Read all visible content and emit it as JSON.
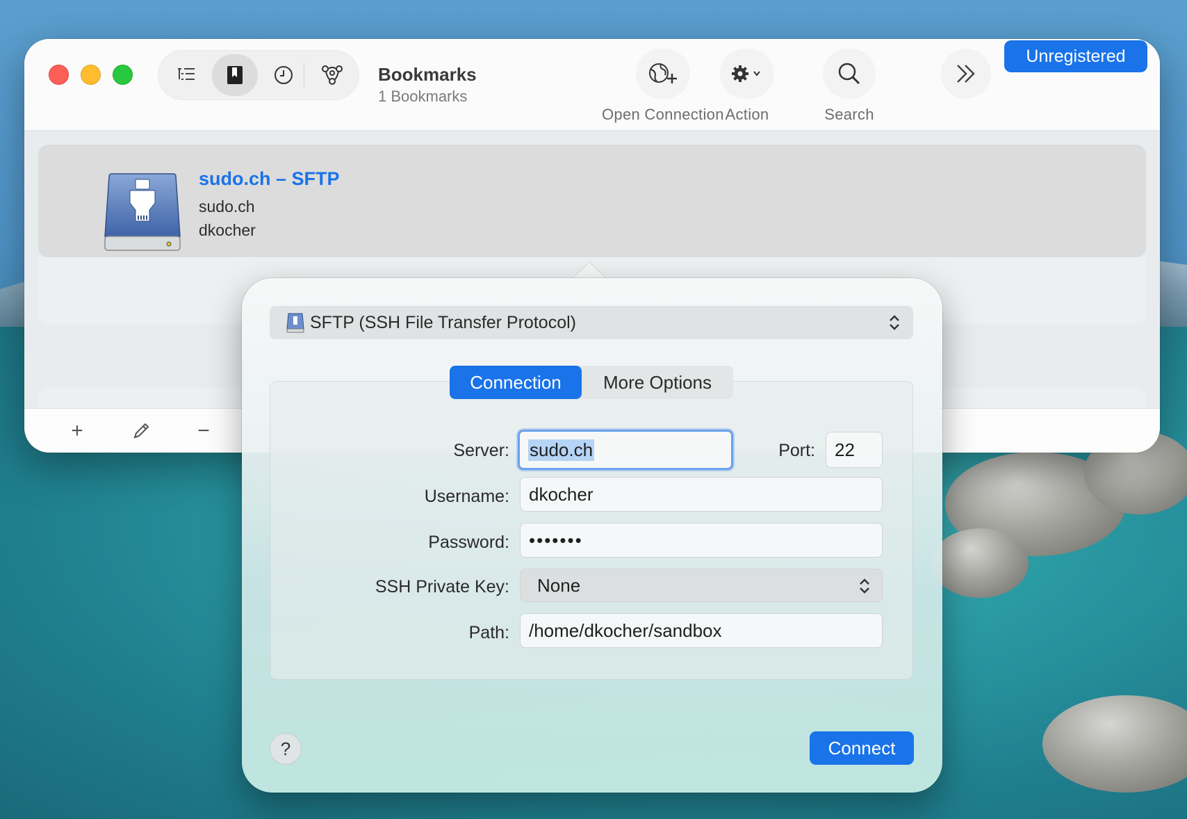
{
  "toolbar": {
    "title": "Bookmarks",
    "subtitle": "1 Bookmarks",
    "open_connection": "Open Connection",
    "action": "Action",
    "search": "Search",
    "unregistered": "Unregistered"
  },
  "bookmark": {
    "title": "sudo.ch – SFTP",
    "host": "sudo.ch",
    "user": "dkocher"
  },
  "bottombar": {
    "add": "+",
    "remove": "−"
  },
  "popover": {
    "protocol": "SFTP (SSH File Transfer Protocol)",
    "tabs": [
      "Connection",
      "More Options"
    ],
    "active_tab": "Connection",
    "server_label": "Server:",
    "server_value": "sudo.ch",
    "port_label": "Port:",
    "port_value": "22",
    "username_label": "Username:",
    "username_value": "dkocher",
    "password_label": "Password:",
    "password_value": "•••••••",
    "ssh_key_label": "SSH Private Key:",
    "ssh_key_value": "None",
    "path_label": "Path:",
    "path_value": "/home/dkocher/sandbox",
    "help": "?",
    "connect": "Connect"
  },
  "colors": {
    "accent": "#1a73e8",
    "close": "#fe5f57",
    "minimize": "#febc2e",
    "zoom": "#28c840"
  }
}
